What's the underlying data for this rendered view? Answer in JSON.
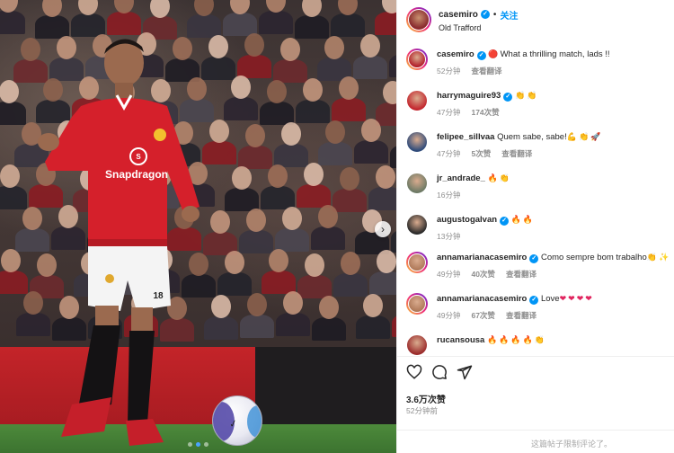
{
  "post": {
    "username": "casemiro",
    "follow_label": "关注",
    "location": "Old Trafford",
    "likes": "3.6万次赞",
    "posted_time": "52分钟前",
    "comments_limited": "这篇帖子限制评论了。"
  },
  "photo": {
    "sponsor": "Snapdragon",
    "shirt_number": "18",
    "slide_count": 3,
    "active_slide": 2
  },
  "comments": [
    {
      "user": "casemiro",
      "verified": true,
      "text": "What a thrilling match, lads !!",
      "emojis_before": [
        "red-circle"
      ],
      "emojis_after": [],
      "time": "52分钟",
      "likes": "",
      "translate": "查看翻译",
      "avatar_color": "#b3202a"
    },
    {
      "user": "harrymaguire93",
      "verified": true,
      "text": "",
      "emojis_before": [],
      "emojis_after": [
        "clap",
        "clap"
      ],
      "time": "47分钟",
      "likes": "174次赞",
      "translate": "",
      "avatar_color": "#c3262e"
    },
    {
      "user": "felipee_sillvaa",
      "verified": false,
      "text": "Quem sabe, sabe!",
      "emojis_before": [],
      "emojis_after": [
        "flex",
        "clap",
        "rocket"
      ],
      "time": "47分钟",
      "likes": "5次赞",
      "translate": "查看翻译",
      "avatar_color": "#2f4b7a"
    },
    {
      "user": "jr_andrade_",
      "verified": false,
      "text": "",
      "emojis_before": [],
      "emojis_after": [
        "fire",
        "clap"
      ],
      "time": "16分钟",
      "likes": "",
      "translate": "",
      "avatar_color": "#6d7a65"
    },
    {
      "user": "augustogalvan",
      "verified": true,
      "text": "",
      "emojis_before": [],
      "emojis_after": [
        "fire",
        "fire"
      ],
      "time": "13分钟",
      "likes": "",
      "translate": "",
      "avatar_color": "#2a2a2a"
    },
    {
      "user": "annamarianacasemiro",
      "verified": true,
      "text": "Como sempre bom trabalho",
      "emojis_before": [],
      "emojis_after": [
        "clap",
        "sparkle"
      ],
      "time": "49分钟",
      "likes": "40次赞",
      "translate": "查看翻译",
      "avatar_color": "#b07a5a"
    },
    {
      "user": "annamarianacasemiro",
      "verified": true,
      "text": "Love",
      "emojis_before": [],
      "emojis_after": [
        "heart",
        "heart",
        "heart",
        "heart"
      ],
      "time": "49分钟",
      "likes": "67次赞",
      "translate": "查看翻译",
      "avatar_color": "#b07a5a"
    },
    {
      "user": "rucansousa",
      "verified": false,
      "text": "",
      "emojis_before": [],
      "emojis_after": [
        "fire",
        "fire",
        "fire",
        "fire",
        "clap"
      ],
      "time": "",
      "likes": "",
      "translate": "",
      "avatar_color": "#9b2c2c"
    }
  ],
  "actions": [
    "heart-icon",
    "comment-icon",
    "share-icon"
  ],
  "colors": {
    "accent": "#0095f6",
    "meta": "#8e8e8e",
    "united_red": "#c42429"
  }
}
